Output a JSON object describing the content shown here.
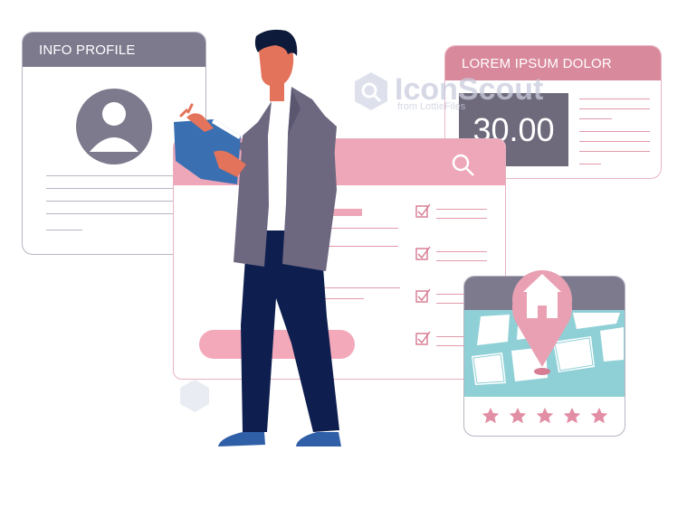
{
  "profile_card": {
    "title": "INFO PROFILE",
    "header_color": "#7e7a8e",
    "avatar_color": "#7e7a8e"
  },
  "price_card": {
    "title": "LOREM IPSUM DOLOR",
    "value": "30.00",
    "header_color": "#d9899c",
    "value_box_color": "#6e6a7c"
  },
  "form_card": {
    "header_color": "#eea7b8",
    "icon": "search-icon",
    "checkbox_icon": "checked-box-icon",
    "checklist_count_visible": 4,
    "button_color": "#f4a9ba"
  },
  "map_card": {
    "header_color": "#7e7a8e",
    "pin_color": "#e9a0b2",
    "icon": "home-icon",
    "rating": 5,
    "rating_max": 5,
    "star_color": "#e28ea4"
  },
  "watermark": {
    "brand": "IconScout",
    "tagline": "from LottieFiles"
  },
  "person": {
    "jacket_color": "#6d6780",
    "pants_color": "#0e1f4f",
    "skin_color": "#e3735a",
    "hair_color": "#0d1a3a",
    "shoes_color": "#2f5fa7",
    "book_color": "#3a6fb2"
  }
}
